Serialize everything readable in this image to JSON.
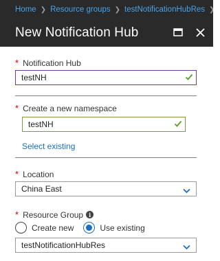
{
  "breadcrumb": {
    "items": [
      "Home",
      "Resource groups",
      "testNotificationHubRes",
      "E"
    ]
  },
  "header": {
    "title": "New Notification Hub",
    "icons": [
      "maximize-icon",
      "close-icon"
    ]
  },
  "form": {
    "hub_name": {
      "label": "Notification Hub",
      "value": "testNH"
    },
    "namespace": {
      "label": "Create a new namespace",
      "value": "testNH",
      "select_existing": "Select existing"
    },
    "location": {
      "label": "Location",
      "value": "China East"
    },
    "resource_group": {
      "label": "Resource Group",
      "info_glyph": "i",
      "option_create": "Create new",
      "option_use": "Use existing",
      "selected_option": "Use existing",
      "value": "testNotificationHubRes"
    }
  },
  "colors": {
    "accent": "#1a6fc4",
    "header_bg": "#2a2a2a",
    "breadcrumb_link": "#4aa2e8",
    "required": "#cc0000",
    "valid_check": "#5a9e2a"
  }
}
